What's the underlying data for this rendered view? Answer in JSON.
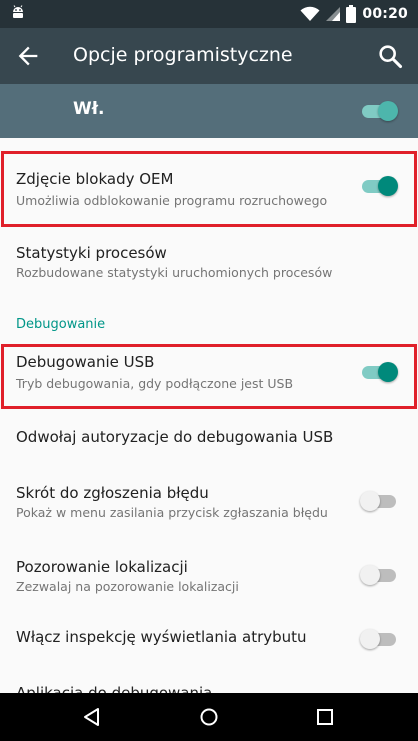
{
  "status_bar": {
    "time": "00:20"
  },
  "app_bar": {
    "title": "Opcje programistyczne"
  },
  "master": {
    "label": "Wł.",
    "enabled": true
  },
  "items": [
    {
      "title": "Zdjęcie blokady OEM",
      "subtitle": "Umożliwia odblokowanie programu rozruchowego",
      "toggle": true,
      "highlighted": true
    },
    {
      "title": "Statystyki procesów",
      "subtitle": "Rozbudowane statystyki uruchomionych procesów"
    },
    {
      "title": "Debugowanie USB",
      "subtitle": "Tryb debugowania, gdy podłączone jest USB",
      "toggle": true,
      "highlighted": true
    },
    {
      "title": "Odwołaj autoryzacje do debugowania USB"
    },
    {
      "title": "Skrót do zgłoszenia błędu",
      "subtitle": "Pokaż w menu zasilania przycisk zgłaszania błędu",
      "toggle": false
    },
    {
      "title": "Pozorowanie lokalizacji",
      "subtitle": "Zezwalaj na pozorowanie lokalizacji",
      "toggle": false
    },
    {
      "title": "Włącz inspekcję wyświetlania atrybutu",
      "toggle": false
    },
    {
      "title": "Aplikacja do debugowania"
    }
  ],
  "section_header": "Debugowanie",
  "colors": {
    "status_bar": "#263238",
    "app_bar": "#37474f",
    "master_bar": "#546e7a",
    "accent": "#009688",
    "highlight": "#e0202a"
  },
  "icons": [
    "android-icon",
    "wifi-icon",
    "signal-icon",
    "battery-icon",
    "back-arrow-icon",
    "search-icon",
    "nav-back-icon",
    "nav-home-icon",
    "nav-recents-icon"
  ]
}
